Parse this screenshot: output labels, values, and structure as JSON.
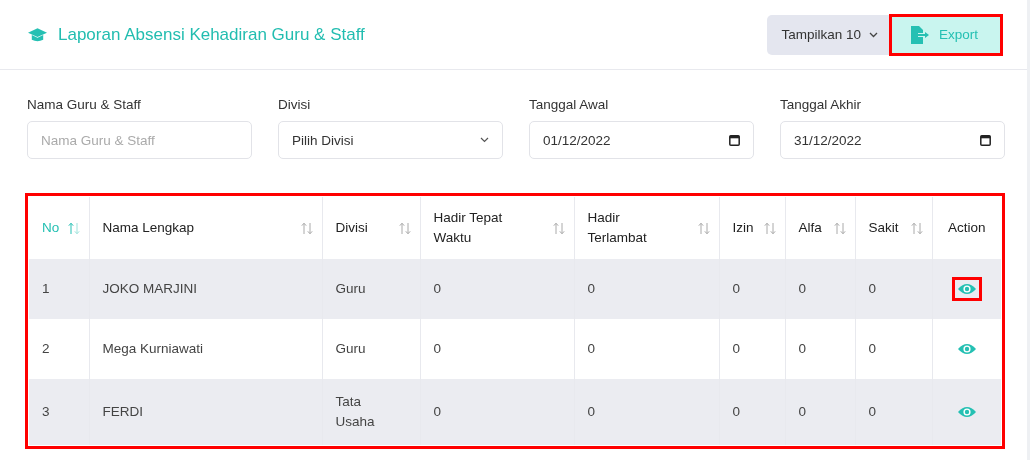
{
  "header": {
    "title": "Laporan Absensi Kehadiran Guru & Staff",
    "page_size_button": "Tampilkan 10",
    "export_button": {
      "label": "Export",
      "highlighted": true
    }
  },
  "filters": [
    {
      "kind": "text",
      "label": "Nama Guru & Staff",
      "placeholder": "Nama Guru & Staff"
    },
    {
      "kind": "select",
      "label": "Divisi",
      "value": "Pilih Divisi"
    },
    {
      "kind": "date",
      "label": "Tanggal Awal",
      "value": "01/12/2022"
    },
    {
      "kind": "date",
      "label": "Tanggal Akhir",
      "value": "31/12/2022"
    }
  ],
  "table": {
    "highlighted": true,
    "columns": [
      {
        "label": "No",
        "sortable": true,
        "selected": true
      },
      {
        "label": "Nama Lengkap",
        "sortable": true,
        "selected": false
      },
      {
        "label": "Divisi",
        "sortable": true,
        "selected": false
      },
      {
        "label": "Hadir Tepat Waktu",
        "sortable": true,
        "selected": false
      },
      {
        "label": "Hadir Terlambat",
        "sortable": true,
        "selected": false
      },
      {
        "label": "Izin",
        "sortable": true,
        "selected": false
      },
      {
        "label": "Alfa",
        "sortable": true,
        "selected": false
      },
      {
        "label": "Sakit",
        "sortable": true,
        "selected": false
      },
      {
        "label": "Action",
        "sortable": false,
        "selected": false
      }
    ],
    "rows": [
      {
        "cells": [
          "1",
          "JOKO MARJINI",
          "Guru",
          "0",
          "0",
          "0",
          "0",
          "0"
        ],
        "action_highlighted": true
      },
      {
        "cells": [
          "2",
          "Mega Kurniawati",
          "Guru",
          "0",
          "0",
          "0",
          "0",
          "0"
        ],
        "action_highlighted": false
      },
      {
        "cells": [
          "3",
          "FERDI",
          "Tata Usaha",
          "0",
          "0",
          "0",
          "0",
          "0"
        ],
        "action_highlighted": false
      }
    ]
  }
}
